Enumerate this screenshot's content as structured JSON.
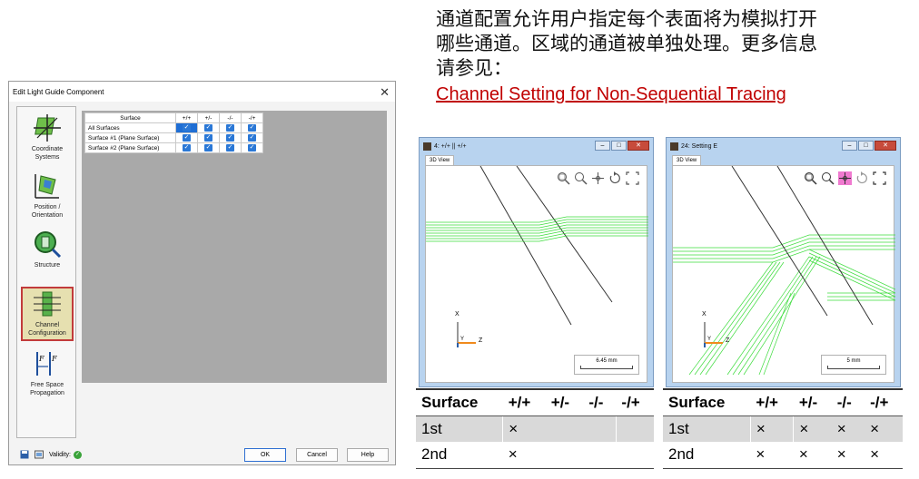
{
  "caption": {
    "line1": "通道配置允许用户指定每个表面将为模拟打开",
    "line2": "哪些通道。区域的通道被单独处理。更多信息",
    "line3": "请参见：",
    "link": "Channel Setting for Non-Sequential Tracing"
  },
  "dialog": {
    "title": "Edit Light Guide Component",
    "sidebar": [
      {
        "label": "Coordinate Systems",
        "icon": "coordinate-systems-icon"
      },
      {
        "label": "Position / Orientation",
        "icon": "position-orientation-icon"
      },
      {
        "label": "Structure",
        "icon": "structure-icon"
      },
      {
        "label": "Channel Configuration",
        "icon": "channel-configuration-icon",
        "active": true
      },
      {
        "label": "Free Space Propagation",
        "icon": "free-space-propagation-icon"
      }
    ],
    "table": {
      "headers": [
        "Surface",
        "+/+",
        "+/-",
        "-/-",
        "-/+"
      ],
      "rows": [
        "All Surfaces",
        "Surface #1 (Plane Surface)",
        "Surface #2 (Plane Surface)"
      ]
    },
    "footer": {
      "validity_label": "Validity:",
      "ok": "OK",
      "cancel": "Cancel",
      "help": "Help"
    }
  },
  "view1": {
    "title": "4: +/+ || +/+",
    "tab": "3D View",
    "scale": "6.45 mm",
    "axis_x": "X",
    "axis_y": "Y",
    "axis_z": "Z"
  },
  "view2": {
    "title": "24: Setting E",
    "tab": "3D View",
    "scale": "5 mm",
    "axis_x": "X",
    "axis_y": "Y",
    "axis_z": "Z"
  },
  "table1": {
    "headers": [
      "Surface",
      "+/+",
      "+/-",
      "-/-",
      "-/+"
    ],
    "rows": [
      {
        "name": "1st",
        "cells": [
          "×",
          "",
          "",
          ""
        ]
      },
      {
        "name": "2nd",
        "cells": [
          "×",
          "",
          "",
          ""
        ]
      }
    ]
  },
  "table2": {
    "headers": [
      "Surface",
      "+/+",
      "+/-",
      "-/-",
      "-/+"
    ],
    "rows": [
      {
        "name": "1st",
        "cells": [
          "×",
          "×",
          "×",
          "×"
        ]
      },
      {
        "name": "2nd",
        "cells": [
          "×",
          "×",
          "×",
          "×"
        ]
      }
    ]
  },
  "colors": {
    "ray_green": "#3ddc3d",
    "link_red": "#c00000",
    "accent_blue": "#2b78d6"
  }
}
